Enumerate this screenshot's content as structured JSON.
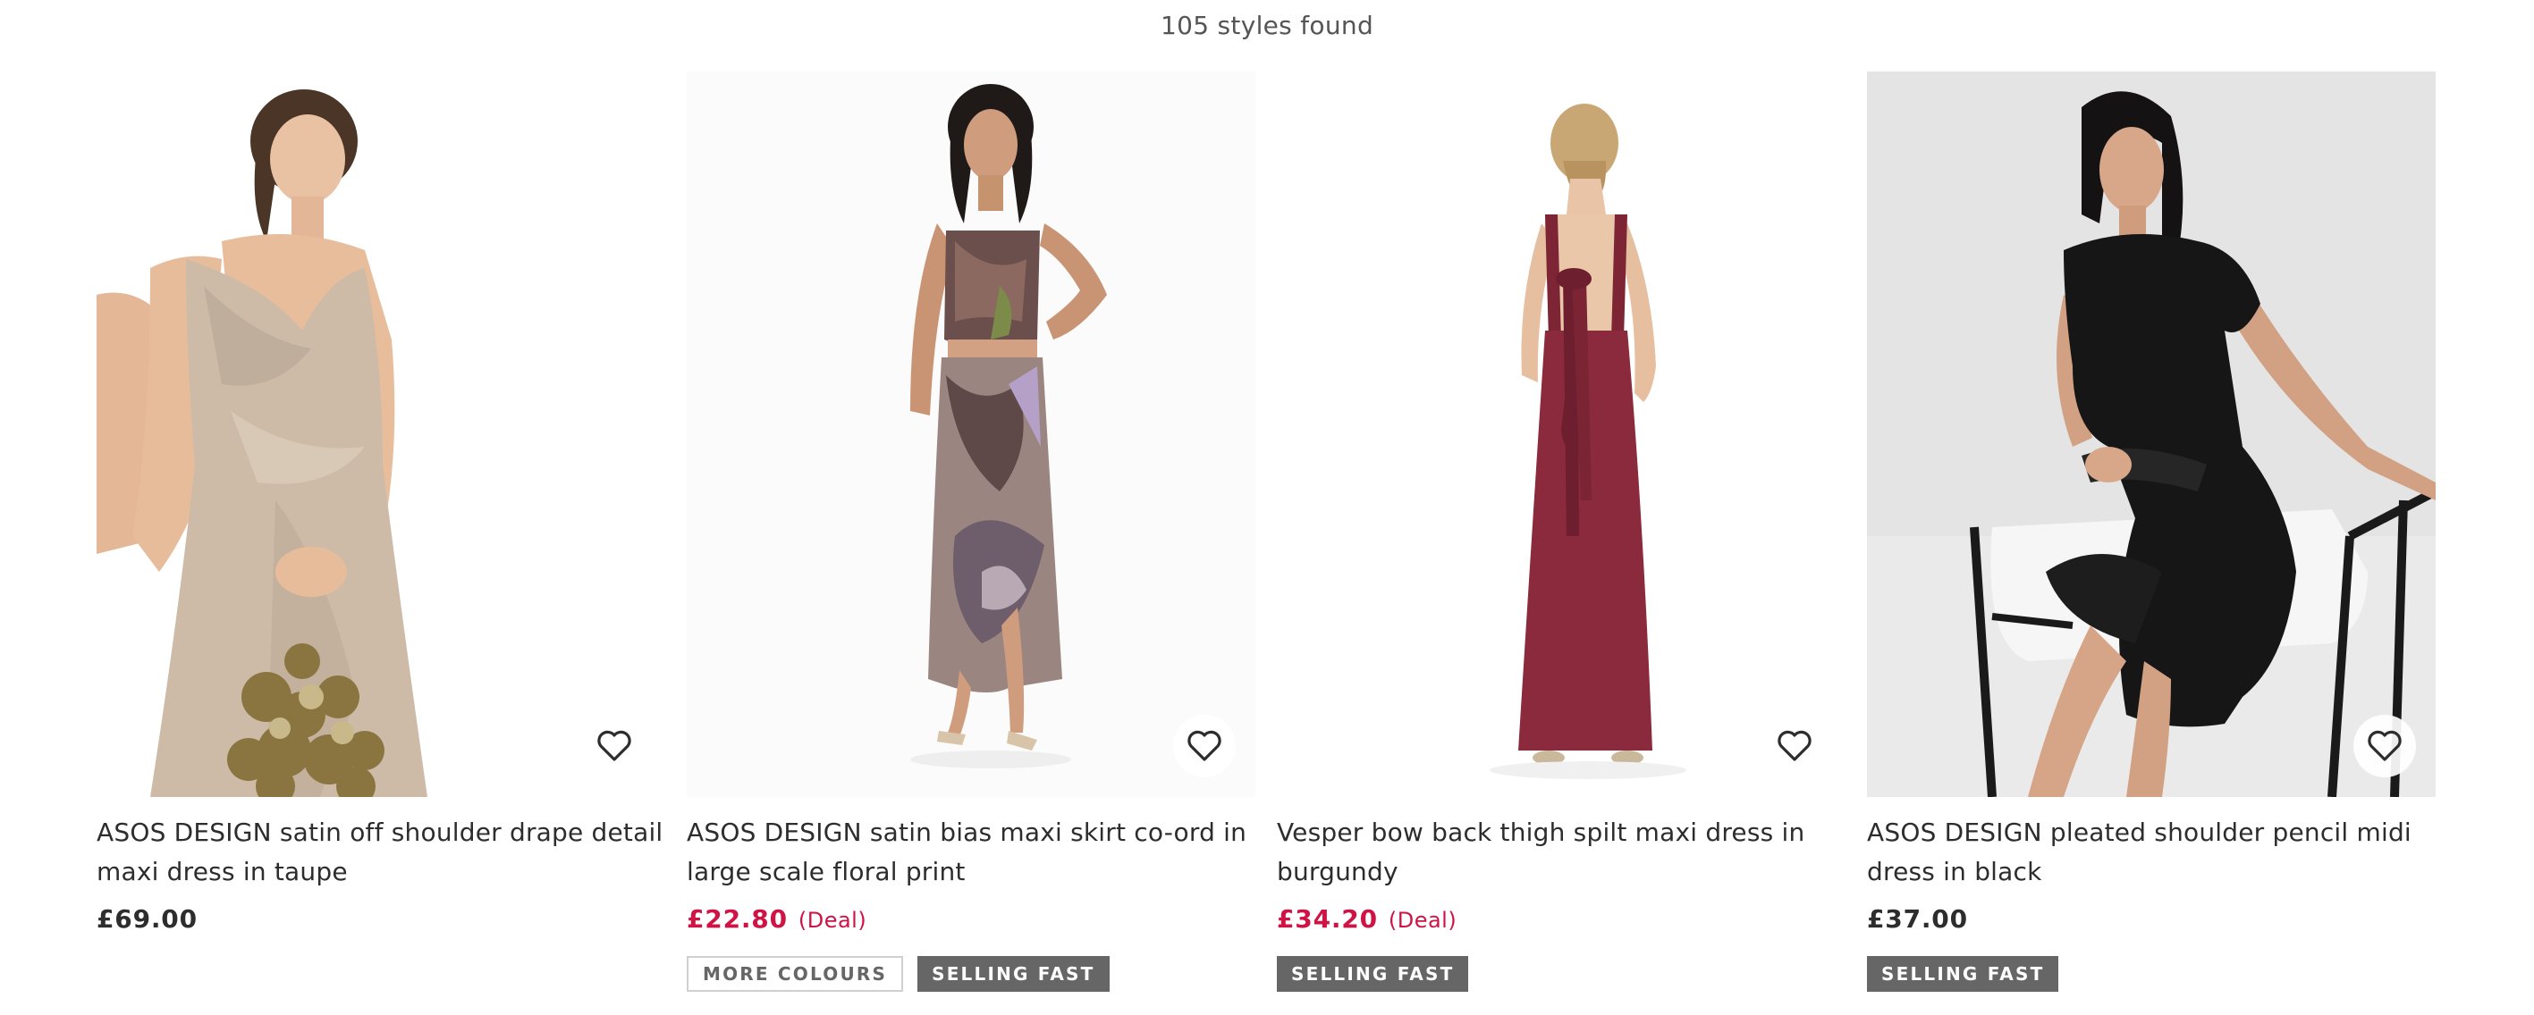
{
  "results": {
    "count_text": "105 styles found"
  },
  "products": [
    {
      "title": "ASOS DESIGN satin off shoulder drape detail maxi dress in taupe",
      "price": "£69.00",
      "on_sale": false,
      "deal_label": "",
      "badges": [],
      "image_subject": "model in taupe satin drape maxi dress holding sequin bag",
      "save_icon": "heart-icon"
    },
    {
      "title": "ASOS DESIGN satin bias maxi skirt co-ord in large scale floral print",
      "price": "£22.80",
      "on_sale": true,
      "deal_label": "(Deal)",
      "badges": [
        "MORE COLOURS",
        "SELLING FAST"
      ],
      "image_subject": "model in floral print satin bandeau top and maxi skirt",
      "save_icon": "heart-icon"
    },
    {
      "title": "Vesper bow back thigh spilt maxi dress in burgundy",
      "price": "£34.20",
      "on_sale": true,
      "deal_label": "(Deal)",
      "badges": [
        "SELLING FAST"
      ],
      "image_subject": "model facing away in burgundy bow back maxi dress",
      "save_icon": "heart-icon"
    },
    {
      "title": "ASOS DESIGN pleated shoulder pencil midi dress in black",
      "price": "£37.00",
      "on_sale": false,
      "deal_label": "",
      "badges": [
        "SELLING FAST"
      ],
      "image_subject": "model in black off shoulder midi dress seated on white chair",
      "save_icon": "heart-icon"
    }
  ],
  "colors": {
    "sale_price": "#d01345",
    "text": "#2d2d2d",
    "badge_solid_bg": "#666666",
    "badge_outline_border": "#d0d0d0"
  }
}
